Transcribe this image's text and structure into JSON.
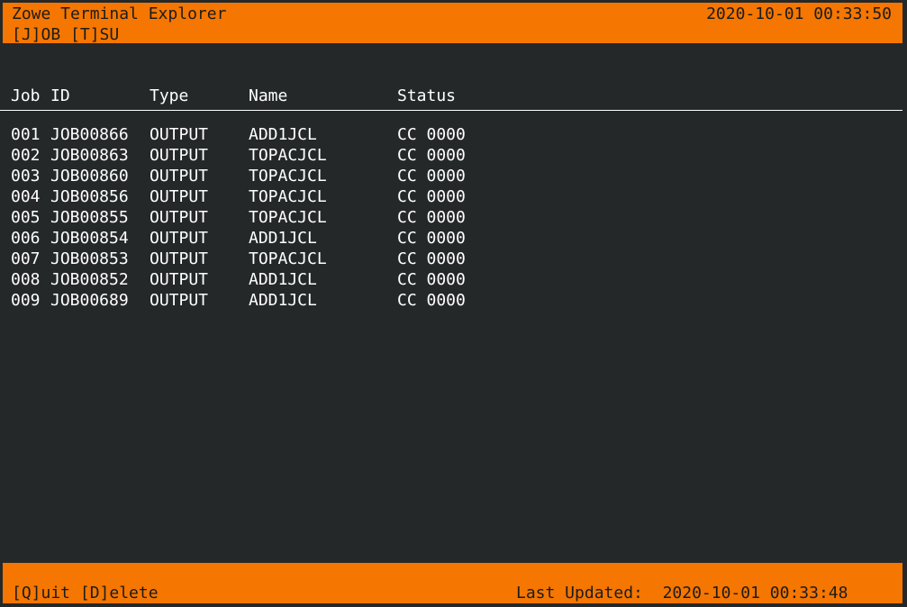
{
  "header": {
    "title": "Zowe Terminal Explorer",
    "menu_job": "[J]OB",
    "menu_tsu": "[T]SU",
    "clock": "2020-10-01 00:33:50"
  },
  "table": {
    "columns": {
      "job": "Job",
      "id": "ID",
      "type": "Type",
      "name": "Name",
      "status": "Status"
    },
    "rows": [
      {
        "num": "001",
        "id": "JOB00866",
        "type": "OUTPUT",
        "name": "ADD1JCL",
        "status": "CC 0000"
      },
      {
        "num": "002",
        "id": "JOB00863",
        "type": "OUTPUT",
        "name": "TOPACJCL",
        "status": "CC 0000"
      },
      {
        "num": "003",
        "id": "JOB00860",
        "type": "OUTPUT",
        "name": "TOPACJCL",
        "status": "CC 0000"
      },
      {
        "num": "004",
        "id": "JOB00856",
        "type": "OUTPUT",
        "name": "TOPACJCL",
        "status": "CC 0000"
      },
      {
        "num": "005",
        "id": "JOB00855",
        "type": "OUTPUT",
        "name": "TOPACJCL",
        "status": "CC 0000"
      },
      {
        "num": "006",
        "id": "JOB00854",
        "type": "OUTPUT",
        "name": "ADD1JCL",
        "status": "CC 0000"
      },
      {
        "num": "007",
        "id": "JOB00853",
        "type": "OUTPUT",
        "name": "TOPACJCL",
        "status": "CC 0000"
      },
      {
        "num": "008",
        "id": "JOB00852",
        "type": "OUTPUT",
        "name": "ADD1JCL",
        "status": "CC 0000"
      },
      {
        "num": "009",
        "id": "JOB00689",
        "type": "OUTPUT",
        "name": "ADD1JCL",
        "status": "CC 0000"
      }
    ]
  },
  "footer": {
    "quit": "[Q]uit",
    "delete": "[D]elete",
    "updated_label": "Last Updated:",
    "updated_value": "2020-10-01 00:33:48"
  },
  "colors": {
    "accent": "#f57600",
    "background": "#252829",
    "text": "#ffffff",
    "bar_text": "#1b1c1d"
  }
}
